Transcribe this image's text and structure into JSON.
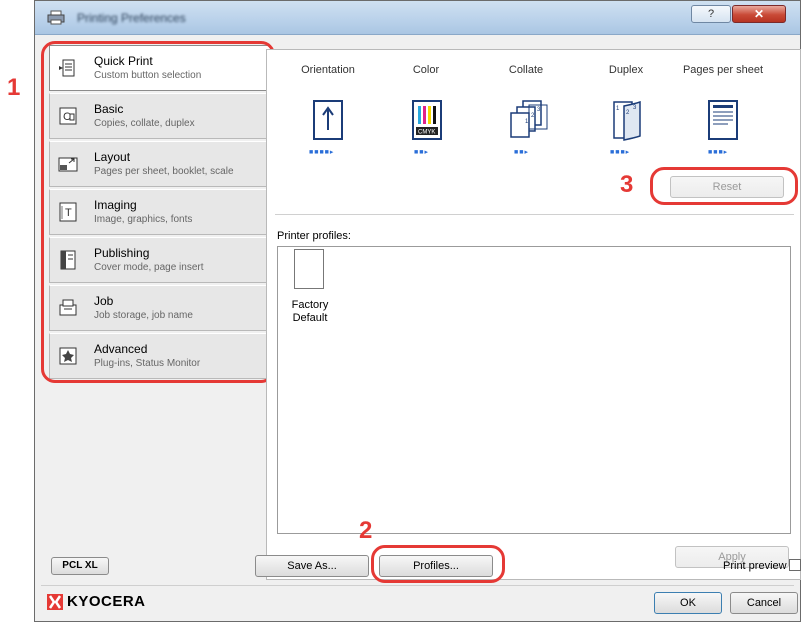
{
  "window": {
    "title": "Printing Preferences",
    "help_label": "?",
    "close_label": "✕"
  },
  "nav": [
    {
      "label": "Quick Print",
      "sub": "Custom button selection",
      "icon": "quick-print-icon"
    },
    {
      "label": "Basic",
      "sub": "Copies, collate, duplex",
      "icon": "basic-icon"
    },
    {
      "label": "Layout",
      "sub": "Pages per sheet, booklet, scale",
      "icon": "layout-icon"
    },
    {
      "label": "Imaging",
      "sub": "Image, graphics, fonts",
      "icon": "imaging-icon"
    },
    {
      "label": "Publishing",
      "sub": "Cover mode, page insert",
      "icon": "publishing-icon"
    },
    {
      "label": "Job",
      "sub": "Job storage, job name",
      "icon": "job-icon"
    },
    {
      "label": "Advanced",
      "sub": "Plug-ins, Status Monitor",
      "icon": "advanced-icon"
    }
  ],
  "quick": {
    "headers": [
      "Orientation",
      "Color",
      "Collate",
      "Duplex",
      "Pages per sheet"
    ],
    "reset_label": "Reset",
    "profiles_label": "Printer profiles:",
    "profile_name_1": "Factory",
    "profile_name_2": "Default",
    "apply_label": "Apply"
  },
  "footer": {
    "pdl_label": "PCL XL",
    "save_as_label": "Save As...",
    "profiles_label": "Profiles...",
    "print_preview_label": "Print preview",
    "ok_label": "OK",
    "cancel_label": "Cancel",
    "brand": "KYOCERA"
  },
  "annotations": {
    "step1": "1",
    "step2": "2",
    "step3": "3"
  },
  "colors": {
    "accent_red": "#e53935",
    "link_blue": "#2a6ed8"
  }
}
